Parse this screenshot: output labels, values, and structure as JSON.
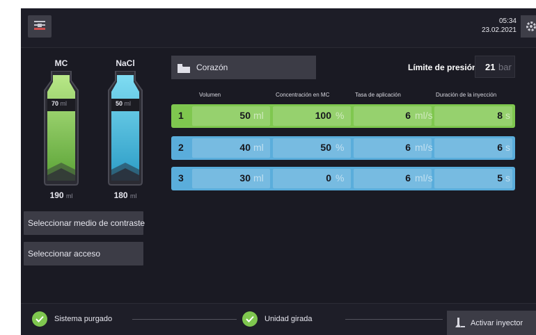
{
  "header": {
    "time": "05:34",
    "date": "23.02.2021"
  },
  "bottles": [
    {
      "name": "MC",
      "fill_level": "70",
      "fill_unit": "ml",
      "volume": "190",
      "volume_unit": "ml",
      "color": "#8fd35a"
    },
    {
      "name": "NaCl",
      "fill_level": "50",
      "fill_unit": "ml",
      "volume": "180",
      "volume_unit": "ml",
      "color": "#4cc3e8"
    }
  ],
  "sidebar": {
    "select_contrast": "Seleccionar medio de contraste",
    "select_access": "Seleccionar acceso"
  },
  "protocol": {
    "name": "Corazón",
    "pressure_limit_label": "Límite de presión",
    "pressure_limit_value": "21",
    "pressure_limit_unit": "bar"
  },
  "columns": [
    "Volumen",
    "Concentración en MC",
    "Tasa de aplicación",
    "Duración de la inyección"
  ],
  "phases": [
    {
      "num": "1",
      "volume": "50",
      "volume_unit": "ml",
      "conc": "100",
      "conc_unit": "%",
      "rate": "6",
      "rate_unit": "ml/s",
      "duration": "8",
      "duration_unit": "s",
      "color": "#7fc74f"
    },
    {
      "num": "2",
      "volume": "40",
      "volume_unit": "ml",
      "conc": "50",
      "conc_unit": "%",
      "rate": "6",
      "rate_unit": "ml/s",
      "duration": "6",
      "duration_unit": "s",
      "color": "#5aaddb"
    },
    {
      "num": "3",
      "volume": "30",
      "volume_unit": "ml",
      "conc": "0",
      "conc_unit": "%",
      "rate": "6",
      "rate_unit": "ml/s",
      "duration": "5",
      "duration_unit": "s",
      "color": "#5aaddb"
    }
  ],
  "status": {
    "purged": "Sistema purgado",
    "rotated": "Unidad girada",
    "activate": "Activar inyector"
  }
}
